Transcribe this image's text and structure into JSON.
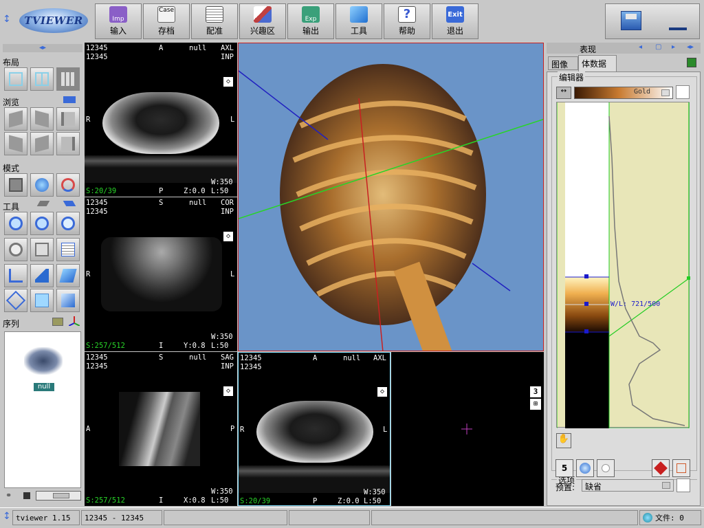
{
  "app": {
    "logo_text": "TVIEWER"
  },
  "toolbar": {
    "buttons": [
      {
        "label": "输入",
        "icon": "import-icon",
        "color": "#8a5fc7"
      },
      {
        "label": "存档",
        "icon": "case-icon",
        "color": "#e0e0e0"
      },
      {
        "label": "配准",
        "icon": "clipboard-icon",
        "color": "#f0f0f0"
      },
      {
        "label": "兴趣区",
        "icon": "roi-icon",
        "color": "#c04040"
      },
      {
        "label": "输出",
        "icon": "export-icon",
        "color": "#3aa07a"
      },
      {
        "label": "工具",
        "icon": "cube-icon",
        "color": "#2a8ad8"
      },
      {
        "label": "帮助",
        "icon": "help-icon",
        "color": "#3a5ad0"
      },
      {
        "label": "退出",
        "icon": "exit-icon",
        "color": "#3a6ad8"
      }
    ],
    "logo_badges": {
      "imp": "Imp",
      "case": "Case",
      "exp": "Exp",
      "exit": "Exit",
      "help": "?"
    }
  },
  "left": {
    "layout_title": "布局",
    "browse_title": "浏览",
    "mode_title": "模式",
    "tools_title": "工具",
    "series_title": "序列",
    "series_item_label": "null"
  },
  "viewports": {
    "axl": {
      "tl1": "12345",
      "tl2": "12345",
      "tc": "A",
      "tr1": "null",
      "tr2": "AXL",
      "tr3": "INP",
      "left": "R",
      "right": "L",
      "w": "W:350",
      "bl": "S:20/39",
      "bc": "P",
      "bz": "Z:0.0",
      "br": "L:50"
    },
    "cor": {
      "tl1": "12345",
      "tl2": "12345",
      "tc": "S",
      "tr1": "null",
      "tr2": "COR",
      "tr3": "INP",
      "left": "R",
      "right": "L",
      "w": "W:350",
      "bl": "S:257/512",
      "bc": "I",
      "bz": "Y:0.8",
      "br": "L:50"
    },
    "sag": {
      "tl1": "12345",
      "tl2": "12345",
      "tc": "S",
      "tr1": "null",
      "tr2": "SAG",
      "tr3": "INP",
      "left": "A",
      "right": "P",
      "w": "W:350",
      "bl": "S:257/512",
      "bc": "I",
      "bz": "X:0.8",
      "br": "L:50"
    },
    "axl2": {
      "tl1": "12345",
      "tl2": "12345",
      "tc": "A",
      "tr1": "null",
      "tr2": "AXL",
      "left": "R",
      "right": "L",
      "w": "W:350",
      "bl": "S:20/39",
      "bc": "P",
      "bz": "Z:0.0",
      "br": "L:50"
    },
    "empty": {
      "badge": "3"
    }
  },
  "right": {
    "panel_title": "表现",
    "tab_image": "图像",
    "tab_volume": "体数据",
    "editor_title": "编辑器",
    "colormap_name": "Gold",
    "wl_label": "W/L: 721/500",
    "options_title": "选项",
    "options_value": "5",
    "preset_label": "预置:",
    "preset_value": "缺省",
    "colors": {
      "background": "#e8e6b8",
      "curve": "#22cc22",
      "handle": "#1a1acc"
    }
  },
  "status": {
    "app_version": "tviewer 1.15",
    "patient": "12345 - 12345",
    "files_label": "文件: 0"
  },
  "colors": {
    "volume_bg": "#6a94c8",
    "overlay_green": "#28d428",
    "border_red": "#c82020",
    "border_cyan": "#80e0ff"
  }
}
